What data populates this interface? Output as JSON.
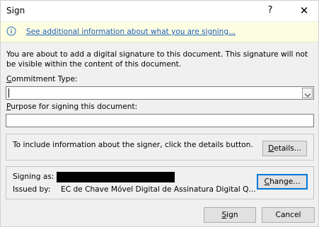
{
  "window": {
    "title": "Sign",
    "help_label": "?",
    "close_label": "✕"
  },
  "infobar": {
    "icon": "info-icon",
    "link_text": "See additional information about what you are signing..."
  },
  "description": "You are about to add a digital signature to this document. This signature will not be visible within the content of this document.",
  "commitment": {
    "label_mnemonic": "C",
    "label_rest": "ommitment Type:",
    "value": ""
  },
  "purpose": {
    "label_mnemonic": "P",
    "label_rest": "urpose for signing this document:",
    "value": ""
  },
  "signer_info": {
    "text": "To include information about the signer, click the details button.",
    "details_mnemonic": "D",
    "details_rest": "etails..."
  },
  "signing": {
    "signing_as_label": "Signing as:",
    "issued_by_label": "Issued by:",
    "issued_by_value": "EC de Chave Móvel Digital de Assinatura Digital Q...",
    "change_mnemonic": "C",
    "change_rest": "hange..."
  },
  "actions": {
    "sign_mnemonic": "S",
    "sign_rest": "ign",
    "cancel_label": "Cancel"
  },
  "colors": {
    "link": "#1f5fbd",
    "infobar_bg": "#fdfde1",
    "default_button_border": "#0078d7"
  }
}
